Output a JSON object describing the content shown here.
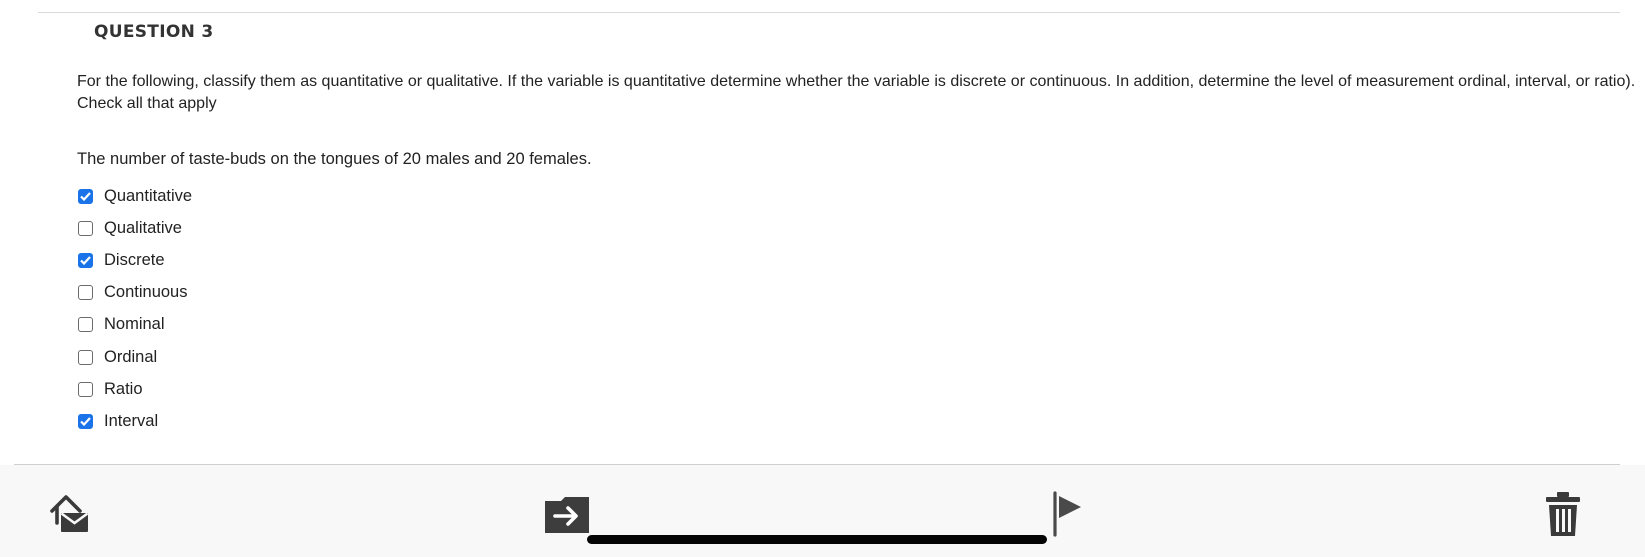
{
  "question": {
    "title": "QUESTION 3",
    "instructions": "For the following, classify them as quantitative or qualitative. If the variable is quantitative determine whether the variable is discrete or continuous. In addition, determine the level of measurement ordinal, interval, or ratio). Check all that apply",
    "prompt": "The number of taste-buds on the tongues of 20 males and 20 females.",
    "options": [
      {
        "label": "Quantitative",
        "checked": true
      },
      {
        "label": "Qualitative",
        "checked": false
      },
      {
        "label": "Discrete",
        "checked": true
      },
      {
        "label": "Continuous",
        "checked": false
      },
      {
        "label": "Nominal",
        "checked": false
      },
      {
        "label": "Ordinal",
        "checked": false
      },
      {
        "label": "Ratio",
        "checked": false
      },
      {
        "label": "Interval",
        "checked": true
      }
    ]
  },
  "toolbar": {
    "icons": [
      "mail-home-icon",
      "move-to-folder-icon",
      "flag-icon",
      "trash-icon"
    ]
  },
  "colors": {
    "checkbox_checked": "#1a73e8",
    "toolbar_background": "#f8f8f8"
  }
}
